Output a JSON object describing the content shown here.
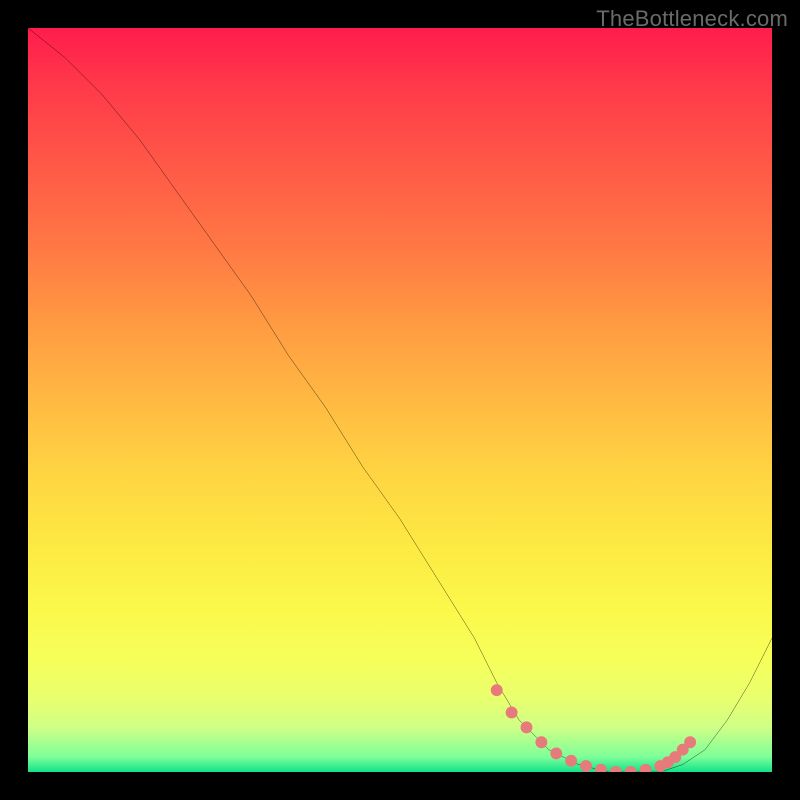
{
  "watermark": "TheBottleneck.com",
  "chart_data": {
    "type": "line",
    "title": "",
    "xlabel": "",
    "ylabel": "",
    "xlim": [
      0,
      100
    ],
    "ylim": [
      0,
      100
    ],
    "grid": false,
    "legend": false,
    "series": [
      {
        "name": "curve",
        "color": "#000000",
        "x": [
          0,
          5,
          10,
          15,
          20,
          25,
          30,
          35,
          40,
          45,
          50,
          55,
          60,
          63,
          66,
          70,
          74,
          78,
          82,
          85,
          88,
          91,
          94,
          97,
          100
        ],
        "y": [
          100,
          96,
          91,
          85,
          78,
          71,
          64,
          56,
          49,
          41,
          34,
          26,
          18,
          12,
          7,
          3,
          1,
          0,
          0,
          0,
          1,
          3,
          7,
          12,
          18
        ]
      },
      {
        "name": "highlight-dots",
        "color": "#e77a7a",
        "x": [
          63,
          65,
          67,
          69,
          71,
          73,
          75,
          77,
          79,
          81,
          83,
          85,
          86,
          87,
          88,
          89
        ],
        "y": [
          11,
          8,
          6,
          4,
          2.5,
          1.5,
          0.8,
          0.3,
          0,
          0,
          0.3,
          0.8,
          1.3,
          2,
          3,
          4
        ]
      }
    ],
    "background_gradient": {
      "stops": [
        {
          "pos": 0,
          "color": "#ff1c4c"
        },
        {
          "pos": 8,
          "color": "#ff3a4a"
        },
        {
          "pos": 18,
          "color": "#ff5747"
        },
        {
          "pos": 30,
          "color": "#ff7a44"
        },
        {
          "pos": 40,
          "color": "#ff9b42"
        },
        {
          "pos": 50,
          "color": "#ffb942"
        },
        {
          "pos": 60,
          "color": "#ffd542"
        },
        {
          "pos": 70,
          "color": "#fdea43"
        },
        {
          "pos": 78,
          "color": "#fbf84a"
        },
        {
          "pos": 85,
          "color": "#f6ff5a"
        },
        {
          "pos": 90,
          "color": "#e9ff6e"
        },
        {
          "pos": 94,
          "color": "#cfff86"
        },
        {
          "pos": 98,
          "color": "#7dff99"
        },
        {
          "pos": 100,
          "color": "#10e28a"
        }
      ]
    }
  }
}
